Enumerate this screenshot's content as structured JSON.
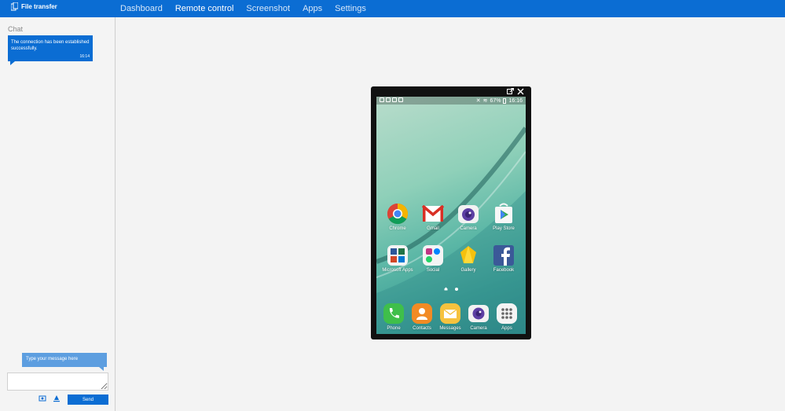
{
  "app": {
    "title": "File transfer"
  },
  "nav": {
    "tabs": [
      {
        "label": "Dashboard",
        "active": false
      },
      {
        "label": "Remote control",
        "active": true
      },
      {
        "label": "Screenshot",
        "active": false
      },
      {
        "label": "Apps",
        "active": false
      },
      {
        "label": "Settings",
        "active": false
      }
    ]
  },
  "chat": {
    "title": "Chat",
    "messages": [
      {
        "text": "The connection has been established successfully.",
        "time": "16:14"
      }
    ],
    "input_placeholder": "Type your message here",
    "send_label": "Send"
  },
  "device": {
    "status": {
      "battery": "67%",
      "time": "16:16"
    },
    "apps_row1": [
      {
        "label": "Chrome",
        "icon": "chrome-icon"
      },
      {
        "label": "Gmail",
        "icon": "gmail-icon"
      },
      {
        "label": "Camera",
        "icon": "camera-icon"
      },
      {
        "label": "Play Store",
        "icon": "play-store-icon"
      }
    ],
    "apps_row2": [
      {
        "label": "Microsoft Apps",
        "icon": "microsoft-apps-icon"
      },
      {
        "label": "Social",
        "icon": "social-icon"
      },
      {
        "label": "Gallery",
        "icon": "gallery-icon"
      },
      {
        "label": "Facebook",
        "icon": "facebook-icon"
      }
    ],
    "dock": [
      {
        "label": "Phone",
        "icon": "phone-icon"
      },
      {
        "label": "Contacts",
        "icon": "contacts-icon"
      },
      {
        "label": "Messages",
        "icon": "messages-icon"
      },
      {
        "label": "Camera",
        "icon": "camera-icon"
      },
      {
        "label": "Apps",
        "icon": "apps-grid-icon"
      }
    ]
  },
  "colors": {
    "accent": "#0b6dd3",
    "hint": "#5d9ee0",
    "background": "#f3f3f3"
  }
}
